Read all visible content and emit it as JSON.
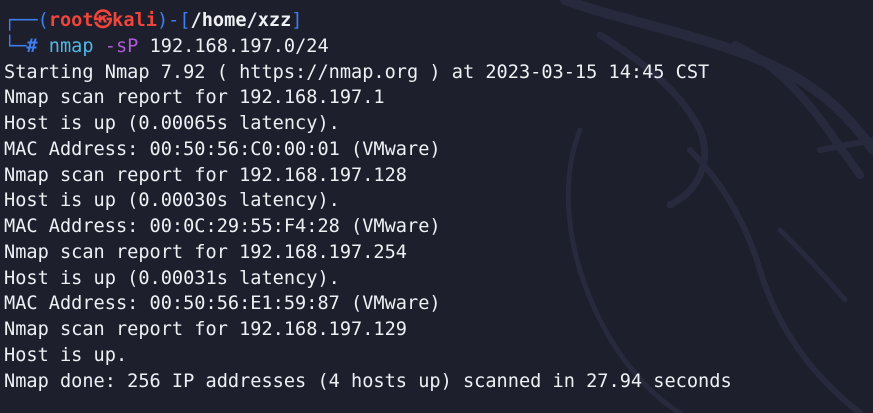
{
  "prompt": {
    "corner_top": "┌──(",
    "user": "root",
    "skull": "㉿",
    "host": "kali",
    "mid": ")-[",
    "path": "/home/xzz",
    "close": "]",
    "corner_bottom": "└─",
    "hash": "#"
  },
  "command": {
    "program": "nmap",
    "flag": "-sP",
    "target": "192.168.197.0/24"
  },
  "output": [
    "Starting Nmap 7.92 ( https://nmap.org ) at 2023-03-15 14:45 CST",
    "Nmap scan report for 192.168.197.1",
    "Host is up (0.00065s latency).",
    "MAC Address: 00:50:56:C0:00:01 (VMware)",
    "Nmap scan report for 192.168.197.128",
    "Host is up (0.00030s latency).",
    "MAC Address: 00:0C:29:55:F4:28 (VMware)",
    "Nmap scan report for 192.168.197.254",
    "Host is up (0.00031s latency).",
    "MAC Address: 00:50:56:E1:59:87 (VMware)",
    "Nmap scan report for 192.168.197.129",
    "Host is up.",
    "Nmap done: 256 IP addresses (4 hosts up) scanned in 27.94 seconds"
  ],
  "colors": {
    "background": "#1d1f2d",
    "bracket_blue": "#3e7ef0",
    "user_red": "#f0453a",
    "command_cyan": "#4fb8e6",
    "flag_purple": "#b15ad8",
    "text_white": "#eef0f4"
  },
  "icons": [
    "kali-dragon-watermark"
  ]
}
